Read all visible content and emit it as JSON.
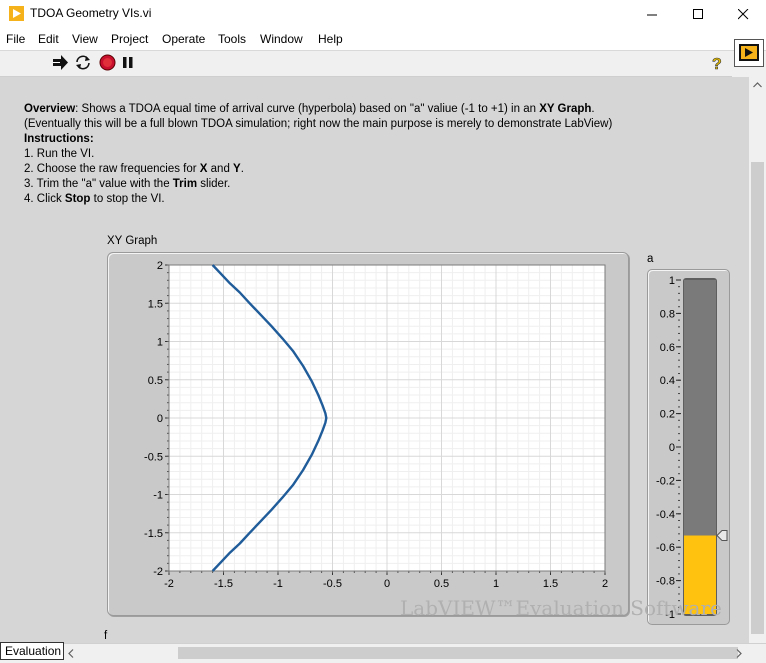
{
  "window": {
    "title": "TDOA Geometry VIs.vi"
  },
  "menu": [
    "File",
    "Edit",
    "View",
    "Project",
    "Operate",
    "Tools",
    "Window",
    "Help"
  ],
  "description": {
    "overview_label": "Overview",
    "overview_text_1": ": Shows a TDOA equal time of arrival curve (hyperbola) based on \"a\" valiue (-1 to +1) in an ",
    "overview_bold": "XY Graph",
    "overview_text_2": ".",
    "note": "(Eventually this will be a full blown TDOA simulation; right now the main purpose is merely to demonstrate LabView)",
    "instructions_label": "Instructions",
    "instructions_colon": ":",
    "step1": "1. Run the VI.",
    "step2_a": "2. Choose the raw frequencies for ",
    "step2_x": "X",
    "step2_and": " and ",
    "step2_y": "Y",
    "step2_end": ".",
    "step3_a": "3. Trim the \"a\" value with the ",
    "step3_trim": "Trim",
    "step3_end": " slider.",
    "step4_a": "4. Click ",
    "step4_stop": "Stop",
    "step4_end": " to stop the VI."
  },
  "graph": {
    "label": "XY Graph"
  },
  "slider": {
    "label": "a",
    "value": -0.53
  },
  "f_label": "f",
  "watermark": "LabVIEW™Evaluation Software",
  "status": "Evaluation",
  "colors": {
    "curve": "#1f5c99",
    "slider_fill": "#ffc20e",
    "slider_track": "#7a7a7a"
  },
  "chart_data": {
    "type": "line",
    "xlabel": "",
    "ylabel": "",
    "xlim": [
      -2,
      2
    ],
    "ylim": [
      -2,
      2
    ],
    "x_ticks": [
      "-2",
      "-1.5",
      "-1",
      "-0.5",
      "0",
      "0.5",
      "1",
      "1.5",
      "2"
    ],
    "y_ticks": [
      "2",
      "1.5",
      "1",
      "0.5",
      "0",
      "-0.5",
      "-1",
      "-1.5",
      "-2"
    ],
    "grid": true,
    "series": [
      {
        "x": [
          -1.6,
          -1.52,
          -1.44,
          -1.35,
          -1.26,
          -1.16,
          -1.06,
          -0.96,
          -0.86,
          -0.77,
          -0.69,
          -0.63,
          -0.59,
          -0.565,
          -0.557,
          -0.565,
          -0.59,
          -0.63,
          -0.69,
          -0.77,
          -0.86,
          -0.96,
          -1.06,
          -1.16,
          -1.26,
          -1.35,
          -1.44,
          -1.52,
          -1.6
        ],
        "y": [
          2.0,
          1.88,
          1.76,
          1.64,
          1.5,
          1.35,
          1.2,
          1.04,
          0.87,
          0.68,
          0.48,
          0.3,
          0.16,
          0.06,
          0.0,
          -0.06,
          -0.16,
          -0.3,
          -0.48,
          -0.68,
          -0.87,
          -1.04,
          -1.2,
          -1.35,
          -1.5,
          -1.64,
          -1.76,
          -1.88,
          -2.0
        ]
      }
    ]
  },
  "slider_scale": {
    "ticks": [
      "1",
      "0.8",
      "0.6",
      "0.4",
      "0.2",
      "0",
      "-0.2",
      "-0.4",
      "-0.6",
      "-0.8",
      "-1"
    ],
    "range": [
      -1,
      1
    ]
  }
}
